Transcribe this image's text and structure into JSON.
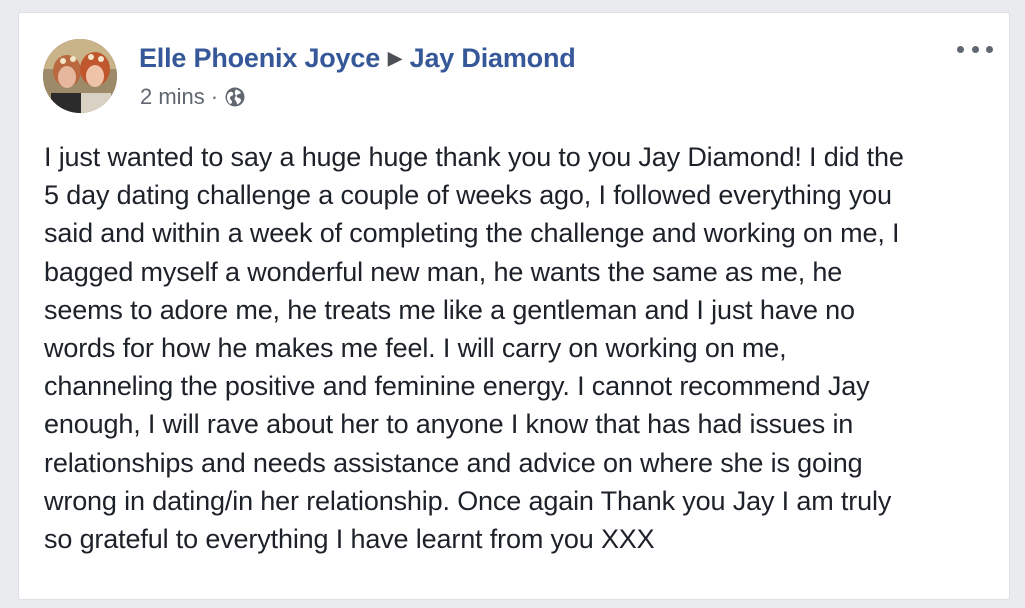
{
  "post": {
    "author": "Elle Phoenix Joyce",
    "recipient": "Jay Diamond",
    "timestamp": "2 mins",
    "separator": "·",
    "privacy_icon": "globe-icon",
    "more_icon": "more-options-icon",
    "lines": [
      "I just wanted to say a huge huge thank you to you Jay Diamond! I did the",
      "5 day dating challenge a couple of weeks ago, I followed everything you",
      "said and within a week of completing the challenge and working on me, I",
      "bagged myself a wonderful new man, he wants the same as me, he",
      "seems to adore me, he treats me like a gentleman and I just have no",
      "words for how he makes me feel. I will carry on working on me,",
      "channeling the positive and feminine energy. I cannot recommend Jay",
      "enough, I will rave about her to anyone I know that has had issues in",
      "relationships and needs assistance and advice on where she is going",
      "wrong in dating/in her relationship. Once again Thank you Jay I am truly",
      "so grateful to everything I have learnt from you XXX"
    ]
  },
  "colors": {
    "link": "#365899",
    "meta": "#616770",
    "text": "#1d2129",
    "background": "#e9ebee",
    "card": "#ffffff"
  }
}
